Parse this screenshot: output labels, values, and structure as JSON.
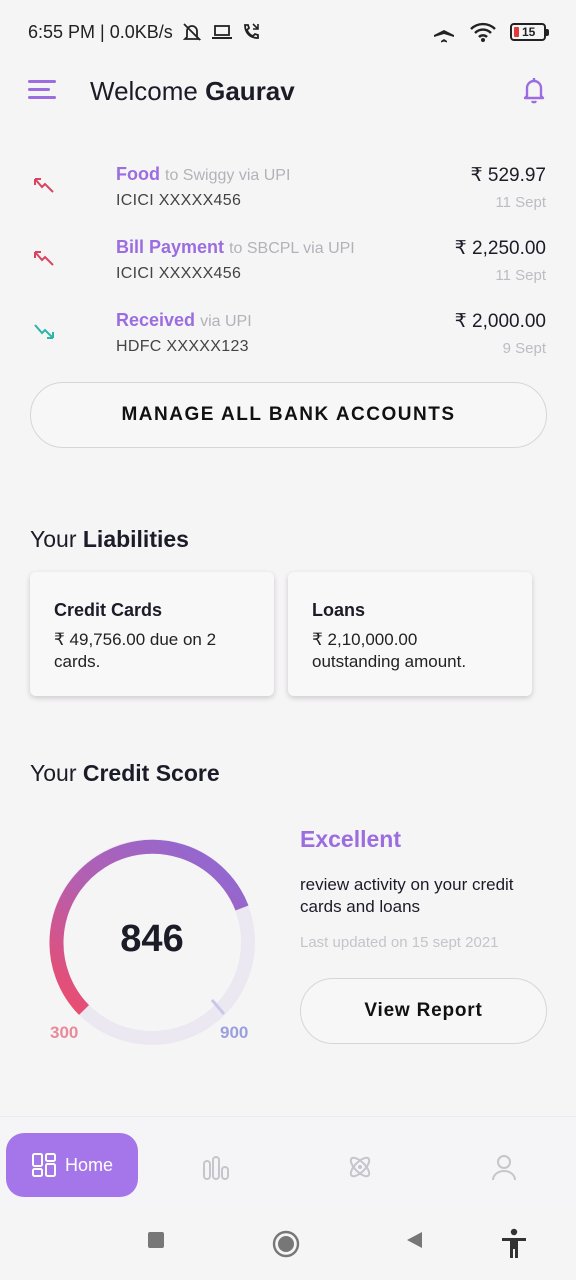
{
  "status_bar": {
    "time_network": "6:55 PM | 0.0KB/s",
    "battery": "15"
  },
  "header": {
    "greeting": "Welcome",
    "user_name": "Gaurav"
  },
  "transactions": [
    {
      "category": "Food",
      "via": "to Swiggy via UPI",
      "account": "ICICI XXXXX456",
      "amount": "₹ 529.97",
      "date": "11 Sept",
      "direction": "debit"
    },
    {
      "category": "Bill Payment",
      "via": "to SBCPL via UPI",
      "account": "ICICI XXXXX456",
      "amount": "₹ 2,250.00",
      "date": "11 Sept",
      "direction": "debit"
    },
    {
      "category": "Received",
      "via": "via UPI",
      "account": "HDFC XXXXX123",
      "amount": "₹ 2,000.00",
      "date": "9 Sept",
      "direction": "credit"
    }
  ],
  "manage_button": "MANAGE ALL BANK ACCOUNTS",
  "liabilities": {
    "prefix": "Your",
    "title": "Liabilities",
    "cards": [
      {
        "title": "Credit Cards",
        "desc": "₹ 49,756.00 due on 2 cards."
      },
      {
        "title": "Loans",
        "desc": "₹ 2,10,000.00 outstanding amount."
      }
    ]
  },
  "credit_score": {
    "prefix": "Your",
    "title": "Credit Score",
    "score": "846",
    "min": "300",
    "max": "900",
    "rating": "Excellent",
    "desc": "review activity on your credit cards and loans",
    "updated": "Last updated on 15 sept 2021",
    "report_button": "View Report"
  },
  "bottom_nav": {
    "home_label": "Home"
  },
  "colors": {
    "accent": "#9b6de0",
    "home_tab": "#a575ea",
    "debit_arrow": "#d9455f",
    "credit_arrow": "#2bb5a8"
  }
}
